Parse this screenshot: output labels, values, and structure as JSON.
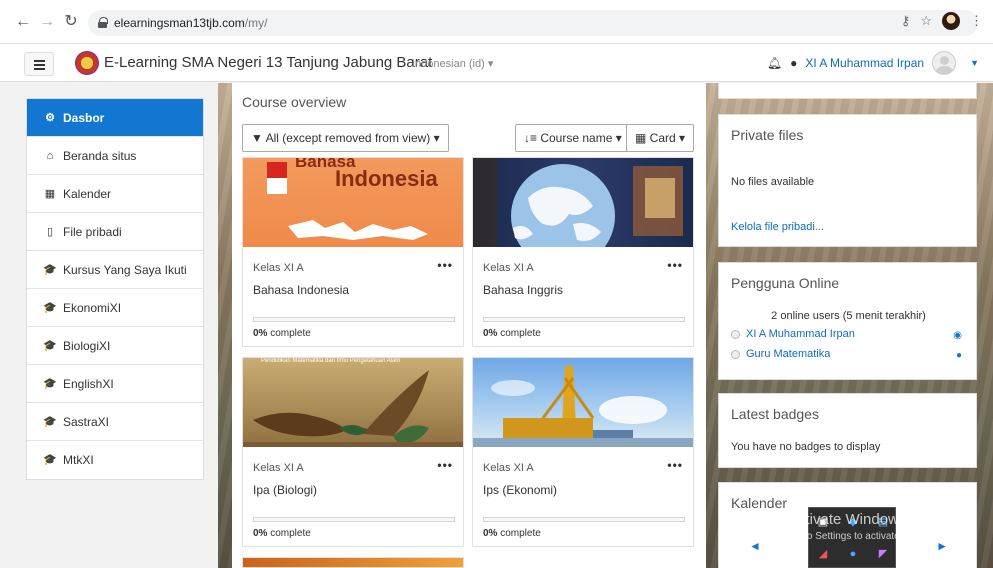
{
  "browser": {
    "url_host": "elearningsman13tjb.com",
    "url_path": "/my/"
  },
  "navbar": {
    "site_name": "E-Learning SMA Negeri 13 Tanjung Jabung Barat",
    "language": "Indonesian (id) ▾",
    "user_name": "XI A Muhammad Irpan"
  },
  "drawer": {
    "items": [
      {
        "label": "Dasbor",
        "icon": "dashboard-icon",
        "glyph": "⚙",
        "active": true
      },
      {
        "label": "Beranda situs",
        "icon": "home-icon",
        "glyph": "⌂"
      },
      {
        "label": "Kalender",
        "icon": "calendar-icon",
        "glyph": "▦"
      },
      {
        "label": "File pribadi",
        "icon": "file-icon",
        "glyph": "▯"
      },
      {
        "label": "Kursus Yang Saya Ikuti",
        "icon": "graduation-cap-icon",
        "glyph": "🎓"
      },
      {
        "label": "EkonomiXI",
        "icon": "graduation-cap-icon",
        "glyph": "🎓"
      },
      {
        "label": "BiologiXI",
        "icon": "graduation-cap-icon",
        "glyph": "🎓"
      },
      {
        "label": "EnglishXI",
        "icon": "graduation-cap-icon",
        "glyph": "🎓"
      },
      {
        "label": "SastraXI",
        "icon": "graduation-cap-icon",
        "glyph": "🎓"
      },
      {
        "label": "MtkXI",
        "icon": "graduation-cap-icon",
        "glyph": "🎓"
      }
    ]
  },
  "main": {
    "title": "Course overview",
    "filter_label": "All (except removed from view) ▾",
    "sort_label": "Course name ▾",
    "view_label": "Card ▾",
    "courses": [
      {
        "category": "Kelas XI A",
        "name": "Bahasa Indonesia",
        "progress_pct": 0,
        "complete_pct": "0%",
        "complete_text": " complete",
        "image_text_1": "Bahasa",
        "image_text_2": "Indonesia"
      },
      {
        "category": "Kelas XI A",
        "name": "Bahasa Inggris",
        "progress_pct": 0,
        "complete_pct": "0%",
        "complete_text": " complete"
      },
      {
        "category": "Kelas XI A",
        "name": "Ipa (Biologi)",
        "progress_pct": 0,
        "complete_pct": "0%",
        "complete_text": " complete",
        "image_text_1": "Pendidikan Matematika dan Ilmu Pengetahuan Alam"
      },
      {
        "category": "Kelas XI A",
        "name": "Ips (Ekonomi)",
        "progress_pct": 0,
        "complete_pct": "0%",
        "complete_text": " complete"
      }
    ]
  },
  "right": {
    "private_files": {
      "title": "Private files",
      "empty_text": "No files available",
      "manage_link": "Kelola file pribadi..."
    },
    "online_users": {
      "title": "Pengguna Online",
      "summary": "2 online users (5 menit terakhir)",
      "users": [
        "XI A Muhammad Irpan",
        "Guru Matematika"
      ]
    },
    "badges": {
      "title": "Latest badges",
      "empty_text": "You have no badges to display"
    },
    "calendar": {
      "title": "Kalender"
    }
  },
  "overlay": {
    "activate_title": "Activate Windows",
    "activate_sub": "Go to Settings to activate Windows."
  },
  "colors": {
    "accent": "#1177d1",
    "link": "#0f6cbf"
  }
}
